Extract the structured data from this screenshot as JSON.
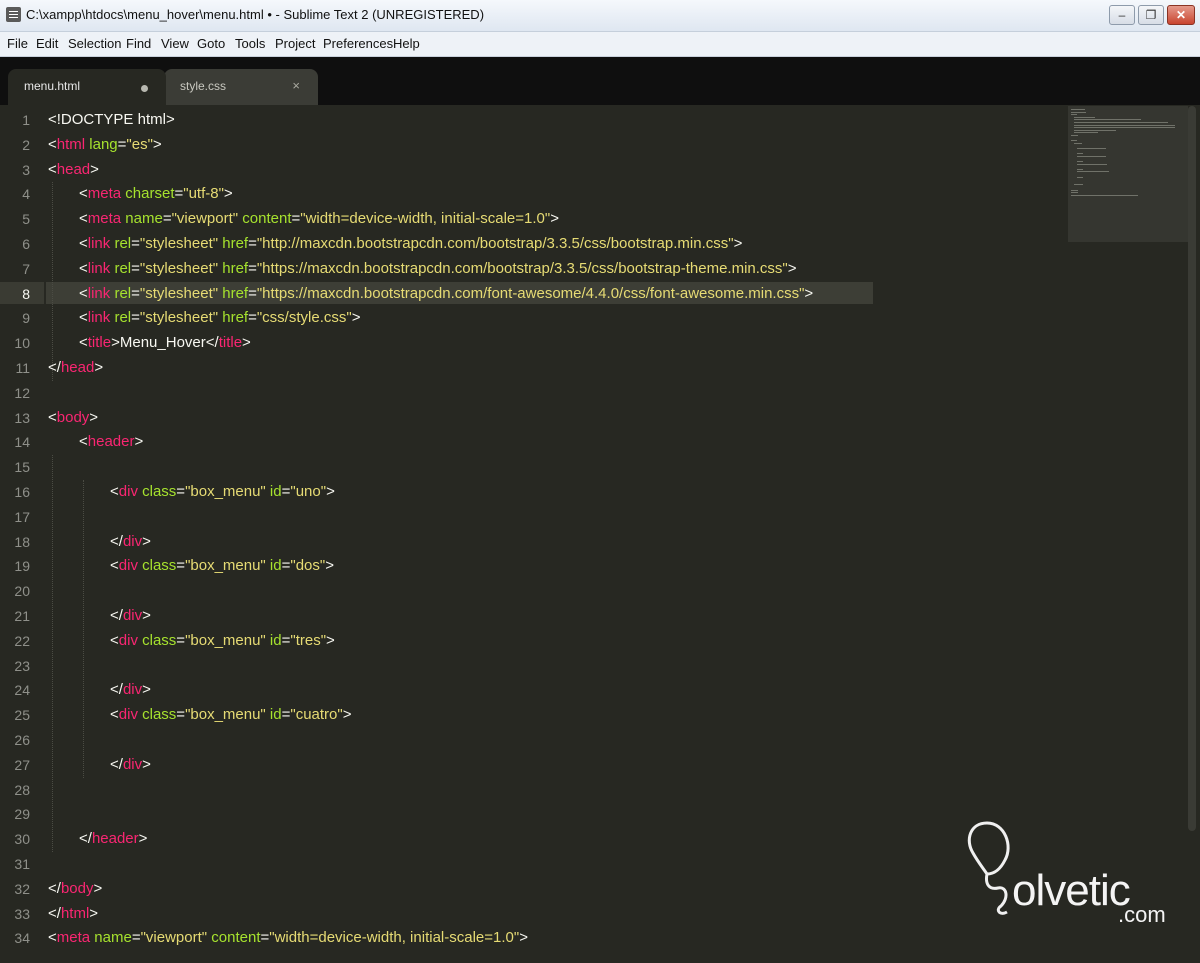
{
  "window": {
    "title": "C:\\xampp\\htdocs\\menu_hover\\menu.html • - Sublime Text 2 (UNREGISTERED)",
    "controls": {
      "minimize": "–",
      "maximize": "❐",
      "close": "✕"
    }
  },
  "menubar": {
    "items": [
      "File",
      "Edit",
      "Selection",
      "Find",
      "View",
      "Goto",
      "Tools",
      "Project",
      "Preferences",
      "Help"
    ]
  },
  "tabs": [
    {
      "label": "menu.html",
      "state": "active",
      "modified": true
    },
    {
      "label": "style.css",
      "state": "inactive",
      "close": "×"
    }
  ],
  "editor": {
    "current_line": 8,
    "lines": [
      {
        "n": "1",
        "tokens": [
          [
            "p",
            "<!DOCTYPE html>"
          ]
        ]
      },
      {
        "n": "2",
        "tokens": [
          [
            "p",
            "<"
          ],
          [
            "t",
            "html"
          ],
          [
            "a",
            " lang"
          ],
          [
            "p",
            "="
          ],
          [
            "s",
            "\"es\""
          ],
          [
            "p",
            ">"
          ]
        ]
      },
      {
        "n": "3",
        "tokens": [
          [
            "p",
            "<"
          ],
          [
            "t",
            "head"
          ],
          [
            "p",
            ">"
          ]
        ]
      },
      {
        "n": "4",
        "indent": 1,
        "tokens": [
          [
            "p",
            "<"
          ],
          [
            "t",
            "meta"
          ],
          [
            "a",
            " charset"
          ],
          [
            "p",
            "="
          ],
          [
            "s",
            "\"utf-8\""
          ],
          [
            "p",
            ">"
          ]
        ]
      },
      {
        "n": "5",
        "indent": 1,
        "tokens": [
          [
            "p",
            "<"
          ],
          [
            "t",
            "meta"
          ],
          [
            "a",
            " name"
          ],
          [
            "p",
            "="
          ],
          [
            "s",
            "\"viewport\""
          ],
          [
            "a",
            " content"
          ],
          [
            "p",
            "="
          ],
          [
            "s",
            "\"width=device-width, initial-scale=1.0\""
          ],
          [
            "p",
            ">"
          ]
        ]
      },
      {
        "n": "6",
        "indent": 1,
        "tokens": [
          [
            "p",
            "<"
          ],
          [
            "t",
            "link"
          ],
          [
            "a",
            " rel"
          ],
          [
            "p",
            "="
          ],
          [
            "s",
            "\"stylesheet\""
          ],
          [
            "a",
            " href"
          ],
          [
            "p",
            "="
          ],
          [
            "s",
            "\"http://maxcdn.bootstrapcdn.com/bootstrap/3.3.5/css/bootstrap.min.css\""
          ],
          [
            "p",
            ">"
          ]
        ]
      },
      {
        "n": "7",
        "indent": 1,
        "tokens": [
          [
            "p",
            "<"
          ],
          [
            "t",
            "link"
          ],
          [
            "a",
            " rel"
          ],
          [
            "p",
            "="
          ],
          [
            "s",
            "\"stylesheet\""
          ],
          [
            "a",
            " href"
          ],
          [
            "p",
            "="
          ],
          [
            "s",
            "\"https://maxcdn.bootstrapcdn.com/bootstrap/3.3.5/css/bootstrap-theme.min.css\""
          ],
          [
            "p",
            ">"
          ]
        ]
      },
      {
        "n": "8",
        "indent": 1,
        "tokens": [
          [
            "p",
            "<"
          ],
          [
            "t",
            "link"
          ],
          [
            "a",
            " rel"
          ],
          [
            "p",
            "="
          ],
          [
            "s",
            "\"stylesheet\""
          ],
          [
            "a",
            " href"
          ],
          [
            "p",
            "="
          ],
          [
            "s",
            "\"https://maxcdn.bootstrapcdn.com/font-awesome/4.4.0/css/font-awesome.min.css\""
          ],
          [
            "p",
            ">"
          ]
        ]
      },
      {
        "n": "9",
        "indent": 1,
        "tokens": [
          [
            "p",
            "<"
          ],
          [
            "t",
            "link"
          ],
          [
            "a",
            " rel"
          ],
          [
            "p",
            "="
          ],
          [
            "s",
            "\"stylesheet\""
          ],
          [
            "a",
            " href"
          ],
          [
            "p",
            "="
          ],
          [
            "s",
            "\"css/style.css\""
          ],
          [
            "p",
            ">"
          ]
        ]
      },
      {
        "n": "10",
        "indent": 1,
        "tokens": [
          [
            "p",
            "<"
          ],
          [
            "t",
            "title"
          ],
          [
            "p",
            ">Menu_Hover</"
          ],
          [
            "t",
            "title"
          ],
          [
            "p",
            ">"
          ]
        ]
      },
      {
        "n": "11",
        "tokens": [
          [
            "p",
            "</"
          ],
          [
            "t",
            "head"
          ],
          [
            "p",
            ">"
          ]
        ]
      },
      {
        "n": "12",
        "tokens": []
      },
      {
        "n": "13",
        "tokens": [
          [
            "p",
            "<"
          ],
          [
            "t",
            "body"
          ],
          [
            "p",
            ">"
          ]
        ]
      },
      {
        "n": "14",
        "indent": 1,
        "tokens": [
          [
            "p",
            "<"
          ],
          [
            "t",
            "header"
          ],
          [
            "p",
            ">"
          ]
        ]
      },
      {
        "n": "15",
        "tokens": []
      },
      {
        "n": "16",
        "indent": 2,
        "tokens": [
          [
            "p",
            "<"
          ],
          [
            "t",
            "div"
          ],
          [
            "a",
            " class"
          ],
          [
            "p",
            "="
          ],
          [
            "s",
            "\"box_menu\""
          ],
          [
            "a",
            " id"
          ],
          [
            "p",
            "="
          ],
          [
            "s",
            "\"uno\""
          ],
          [
            "p",
            ">"
          ]
        ]
      },
      {
        "n": "17",
        "tokens": []
      },
      {
        "n": "18",
        "indent": 2,
        "tokens": [
          [
            "p",
            "</"
          ],
          [
            "t",
            "div"
          ],
          [
            "p",
            ">"
          ]
        ]
      },
      {
        "n": "19",
        "indent": 2,
        "tokens": [
          [
            "p",
            "<"
          ],
          [
            "t",
            "div"
          ],
          [
            "a",
            " class"
          ],
          [
            "p",
            "="
          ],
          [
            "s",
            "\"box_menu\""
          ],
          [
            "a",
            " id"
          ],
          [
            "p",
            "="
          ],
          [
            "s",
            "\"dos\""
          ],
          [
            "p",
            ">"
          ]
        ]
      },
      {
        "n": "20",
        "tokens": []
      },
      {
        "n": "21",
        "indent": 2,
        "tokens": [
          [
            "p",
            "</"
          ],
          [
            "t",
            "div"
          ],
          [
            "p",
            ">"
          ]
        ]
      },
      {
        "n": "22",
        "indent": 2,
        "tokens": [
          [
            "p",
            "<"
          ],
          [
            "t",
            "div"
          ],
          [
            "a",
            " class"
          ],
          [
            "p",
            "="
          ],
          [
            "s",
            "\"box_menu\""
          ],
          [
            "a",
            " id"
          ],
          [
            "p",
            "="
          ],
          [
            "s",
            "\"tres\""
          ],
          [
            "p",
            ">"
          ]
        ]
      },
      {
        "n": "23",
        "tokens": []
      },
      {
        "n": "24",
        "indent": 2,
        "tokens": [
          [
            "p",
            "</"
          ],
          [
            "t",
            "div"
          ],
          [
            "p",
            ">"
          ]
        ]
      },
      {
        "n": "25",
        "indent": 2,
        "tokens": [
          [
            "p",
            "<"
          ],
          [
            "t",
            "div"
          ],
          [
            "a",
            " class"
          ],
          [
            "p",
            "="
          ],
          [
            "s",
            "\"box_menu\""
          ],
          [
            "a",
            " id"
          ],
          [
            "p",
            "="
          ],
          [
            "s",
            "\"cuatro\""
          ],
          [
            "p",
            ">"
          ]
        ]
      },
      {
        "n": "26",
        "tokens": []
      },
      {
        "n": "27",
        "indent": 2,
        "tokens": [
          [
            "p",
            "</"
          ],
          [
            "t",
            "div"
          ],
          [
            "p",
            ">"
          ]
        ]
      },
      {
        "n": "28",
        "tokens": []
      },
      {
        "n": "29",
        "tokens": []
      },
      {
        "n": "30",
        "indent": 1,
        "tokens": [
          [
            "p",
            "</"
          ],
          [
            "t",
            "header"
          ],
          [
            "p",
            ">"
          ]
        ]
      },
      {
        "n": "31",
        "tokens": []
      },
      {
        "n": "32",
        "tokens": [
          [
            "p",
            "</"
          ],
          [
            "t",
            "body"
          ],
          [
            "p",
            ">"
          ]
        ]
      },
      {
        "n": "33",
        "tokens": [
          [
            "p",
            "</"
          ],
          [
            "t",
            "html"
          ],
          [
            "p",
            ">"
          ]
        ]
      },
      {
        "n": "34",
        "tokens": [
          [
            "p",
            "<"
          ],
          [
            "t",
            "meta"
          ],
          [
            "a",
            " name"
          ],
          [
            "p",
            "="
          ],
          [
            "s",
            "\"viewport\""
          ],
          [
            "a",
            " content"
          ],
          [
            "p",
            "="
          ],
          [
            "s",
            "\"width=device-width, initial-scale=1.0\""
          ],
          [
            "p",
            ">"
          ]
        ]
      }
    ]
  },
  "watermark": {
    "name": "olvetic",
    "suffix": ".com"
  },
  "colors": {
    "background": "#272822",
    "tag": "#f92672",
    "attr": "#a6e22e",
    "string": "#e6db74",
    "text": "#f8f8f2"
  }
}
